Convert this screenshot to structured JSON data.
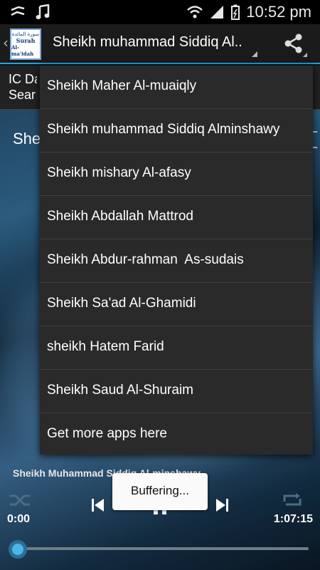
{
  "status_bar": {
    "time": "10:52 pm",
    "left_icons": [
      "signal-sync-icon",
      "music-note-icon"
    ],
    "right_icons": [
      "wifi-icon",
      "cell-signal-icon",
      "battery-icon"
    ]
  },
  "action_bar": {
    "logo_line1": "سورة المائدة",
    "logo_line2": "Surah",
    "logo_line3": "Al-ma'idah",
    "title": "Sheikh muhammad Siddiq Al..",
    "share_icon": "share-icon"
  },
  "background": {
    "search_text": "IC Da\nSear",
    "current_track_text": "She"
  },
  "menu": {
    "items": [
      "Sheikh Maher Al-muaiqly",
      "Sheikh muhammad Siddiq Alminshawy",
      "Sheikh mishary Al-afasy",
      "Sheikh Abdallah Mattrod",
      "Sheikh Abdur-rahman  As-sudais",
      "Sheikh Sa'ad Al-Ghamidi",
      "sheikh Hatem Farid",
      "Sheikh Saud Al-Shuraim",
      "Get more apps here"
    ]
  },
  "player": {
    "now_playing": "Sheikh Muhammad Siddiq Al-minshawy",
    "time_elapsed": "0:00",
    "time_total": "1:07:15",
    "progress": 0.0
  },
  "toast": {
    "text": "Buffering..."
  },
  "colors": {
    "accent": "#2d9fd8",
    "menu_bg": "#2a2a2a",
    "seek_thumb": "#4bb7e8"
  }
}
